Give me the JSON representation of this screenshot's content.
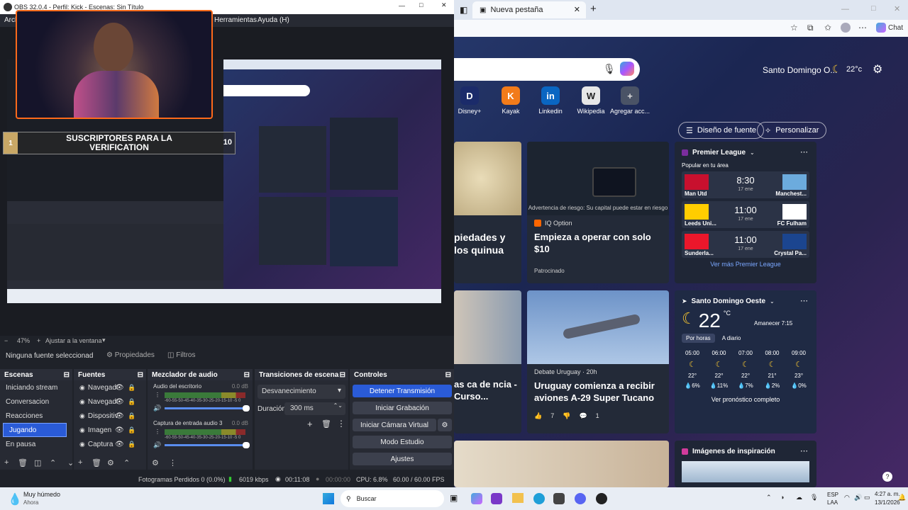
{
  "obs": {
    "title": "OBS 32.0.4 - Perfil: Kick - Escenas: Sin Título",
    "menu": [
      "Arch",
      "Herramientas",
      "Ayuda (H)"
    ],
    "overlay_text": "SUSCRIPTORES PARA LA VERIFICATION",
    "overlay_left_num": "1",
    "overlay_right_num": "10",
    "zoom": "47%",
    "fit_label": "Ajustar a la ventana",
    "no_source_label": "Ninguna fuente seleccionad",
    "properties_label": "Propiedades",
    "filters_label": "Filtros",
    "docks": {
      "scenes": {
        "title": "Escenas",
        "items": [
          "Iniciando stream",
          "Conversacion",
          "Reacciones",
          "Jugando",
          "En pausa"
        ],
        "selected": "Jugando"
      },
      "sources": {
        "title": "Fuentes",
        "items": [
          "Navegador",
          "Navegador",
          "Dispositivo",
          "Imagen",
          "Captura"
        ]
      },
      "mixer": {
        "title": "Mezclador de audio",
        "channels": [
          {
            "name": "Audio del escritorio",
            "db": "0.0 dB"
          },
          {
            "name": "Captura de entrada audio 3",
            "db": "0.0 dB"
          }
        ],
        "scale": "-60-55-50-45-40-35-30-25-20-15-10 -5 0"
      },
      "transitions": {
        "title": "Transiciones de escena",
        "type": "Desvanecimiento",
        "duration_label": "Duración",
        "duration_value": "300 ms"
      },
      "controls": {
        "title": "Controles",
        "buttons": [
          "Detener Transmisión",
          "Iniciar Grabación",
          "Iniciar Cámara Virtual",
          "Modo Estudio",
          "Ajustes"
        ]
      }
    },
    "status": {
      "dropped": "Fotogramas Perdidos 0 (0.0%)",
      "bitrate": "6019 kbps",
      "stream_time": "00:11:08",
      "rec_time": "00:00:00",
      "cpu": "CPU: 6.8%",
      "fps": "60.00 / 60.00 FPS"
    }
  },
  "browser": {
    "tab_title": "Nueva pestaña",
    "chat_label": "Chat",
    "location": "Santo Domingo O...",
    "temp_header": "22°c",
    "shortcuts": [
      {
        "label": "Disney+",
        "letter": "D",
        "color": "#1b2b6a"
      },
      {
        "label": "Kayak",
        "letter": "K",
        "color": "#f27b1a"
      },
      {
        "label": "Linkedin",
        "letter": "in",
        "color": "#0a66c2"
      },
      {
        "label": "Wikipedia",
        "letter": "W",
        "color": "#e7e7e7"
      },
      {
        "label": "Agregar acc...",
        "letter": "+",
        "color": "#4a5366"
      }
    ],
    "feed_design": "Diseño de fuente",
    "personalize": "Personalizar",
    "cards": {
      "quinoa_title": "piedades y los quinua",
      "iq_risk": "Advertencia de riesgo: Su capital puede estar en riesgo",
      "iq_source": "IQ Option",
      "iq_title": "Empieza a operar con solo $10",
      "iq_sponsored": "Patrocinado",
      "course_title": "as ca de ncia - Curso...",
      "uru_source": "Debate Uruguay · 20h",
      "uru_title": "Uruguay comienza a recibir aviones A-29 Super Tucano",
      "uru_likes": "7",
      "uru_comments": "1"
    },
    "premier": {
      "title": "Premier League",
      "popular": "Popular en tu área",
      "matches": [
        {
          "home": "Man Utd",
          "away": "Manchest...",
          "time": "8:30",
          "date": "17 ene",
          "hc": "#c8102e",
          "ac": "#6cabdd"
        },
        {
          "home": "Leeds Uni...",
          "away": "FC Fulham",
          "time": "11:00",
          "date": "17 ene",
          "hc": "#ffcd00",
          "ac": "#ffffff"
        },
        {
          "home": "Sunderla...",
          "away": "Crystal Pa...",
          "time": "11:00",
          "date": "17 ene",
          "hc": "#eb172b",
          "ac": "#1b458f"
        }
      ],
      "more": "Ver más Premier League"
    },
    "weather": {
      "location": "Santo Domingo Oeste",
      "temp": "22",
      "unit": "°C",
      "sunrise": "Amanecer 7:15",
      "tab_hourly": "Por horas",
      "tab_daily": "A diario",
      "hours": [
        {
          "h": "05:00",
          "t": "22°",
          "p": "6%"
        },
        {
          "h": "06:00",
          "t": "22°",
          "p": "11%"
        },
        {
          "h": "07:00",
          "t": "22°",
          "p": "7%"
        },
        {
          "h": "08:00",
          "t": "21°",
          "p": "2%"
        },
        {
          "h": "09:00",
          "t": "23°",
          "p": "0%"
        }
      ],
      "full": "Ver pronóstico completo"
    },
    "inspiration": "Imágenes de inspiración"
  },
  "taskbar": {
    "weather_title": "Muy húmedo",
    "weather_sub": "Ahora",
    "search": "Buscar",
    "lang": "ESP",
    "lang2": "LAA",
    "time": "4:27 a. m.",
    "date": "13/1/2026"
  }
}
